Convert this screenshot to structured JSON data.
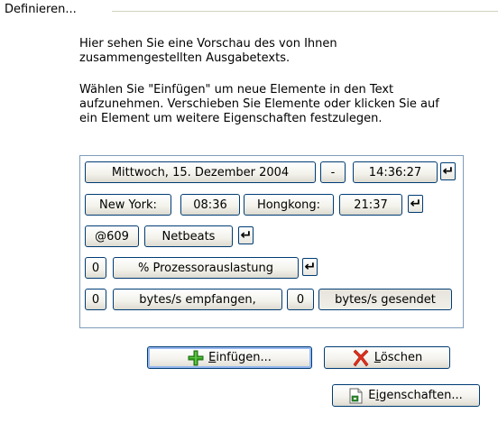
{
  "group": {
    "title": "Definieren..."
  },
  "description": {
    "line1": "Hier sehen Sie eine Vorschau des von Ihnen",
    "line2": "zusammengestellten Ausgabetexts.",
    "line3": "Wählen Sie \"Einfügen\" um neue Elemente in den Text",
    "line4": "aufzunehmen. Verschieben Sie Elemente oder klicken Sie auf",
    "line5": "ein Element um weitere Eigenschaften festzulegen."
  },
  "preview": {
    "rows": [
      {
        "elements": [
          "Mittwoch, 15. Dezember 2004",
          "-",
          "14:36:27"
        ]
      },
      {
        "elements": [
          "New York:",
          "08:36",
          "Hongkong:",
          "21:37"
        ]
      },
      {
        "elements": [
          "@609",
          "Netbeats"
        ]
      },
      {
        "elements": [
          "0",
          "% Prozessorauslastung"
        ]
      },
      {
        "elements": [
          "0",
          "bytes/s empfangen,",
          "0",
          "bytes/s gesendet"
        ]
      }
    ],
    "newline_glyph": "↵"
  },
  "buttons": {
    "insert": {
      "underline": "E",
      "rest": "infügen..."
    },
    "delete": {
      "underline": "L",
      "rest": "öschen"
    },
    "properties": {
      "before": "E",
      "underline": "i",
      "rest": "genschaften..."
    }
  },
  "icons": {
    "insert": "plus-icon",
    "delete": "delete-x-icon",
    "properties": "properties-document-icon"
  },
  "colors": {
    "button_border": "#003c74",
    "preview_border": "#7f9db9",
    "plus_green": "#33a01e",
    "delete_red": "#e0301e"
  }
}
